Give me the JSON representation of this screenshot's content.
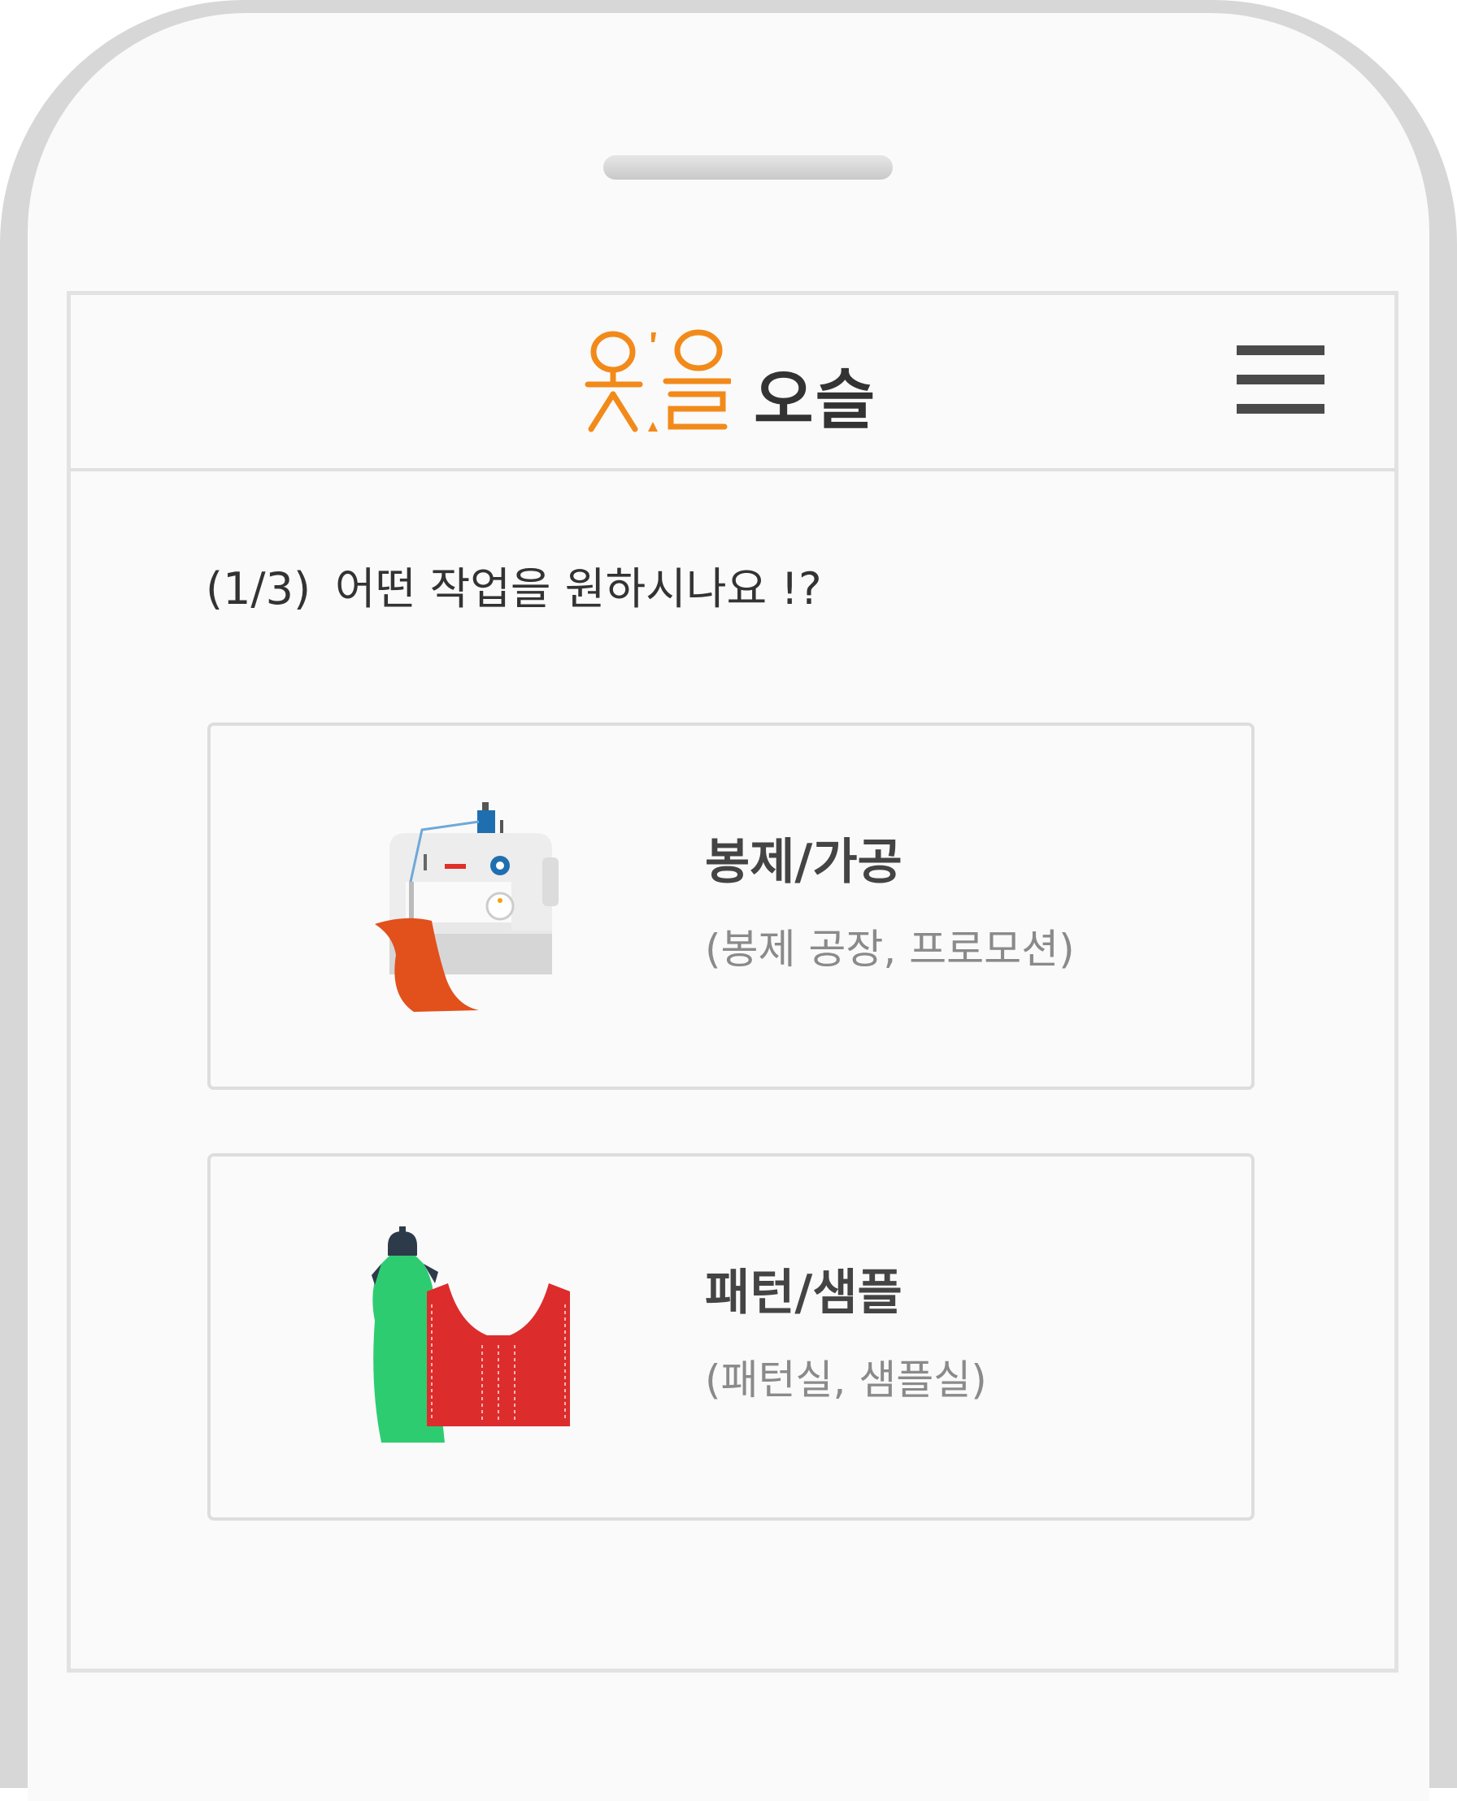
{
  "header": {
    "logo_text": "옷을",
    "brand_name": "오슬"
  },
  "question": {
    "step": "(1/3)",
    "text": "어떤 작업을 원하시나요 !?"
  },
  "options": [
    {
      "title": "봉제/가공",
      "subtitle": "(봉제 공장, 프로모션)",
      "icon": "sewing-machine-icon"
    },
    {
      "title": "패턴/샘플",
      "subtitle": "(패턴실, 샘플실)",
      "icon": "dress-pattern-icon"
    }
  ],
  "colors": {
    "brand_orange": "#f28a1a",
    "text_dark": "#333333",
    "text_sub": "#8a8a8a"
  }
}
